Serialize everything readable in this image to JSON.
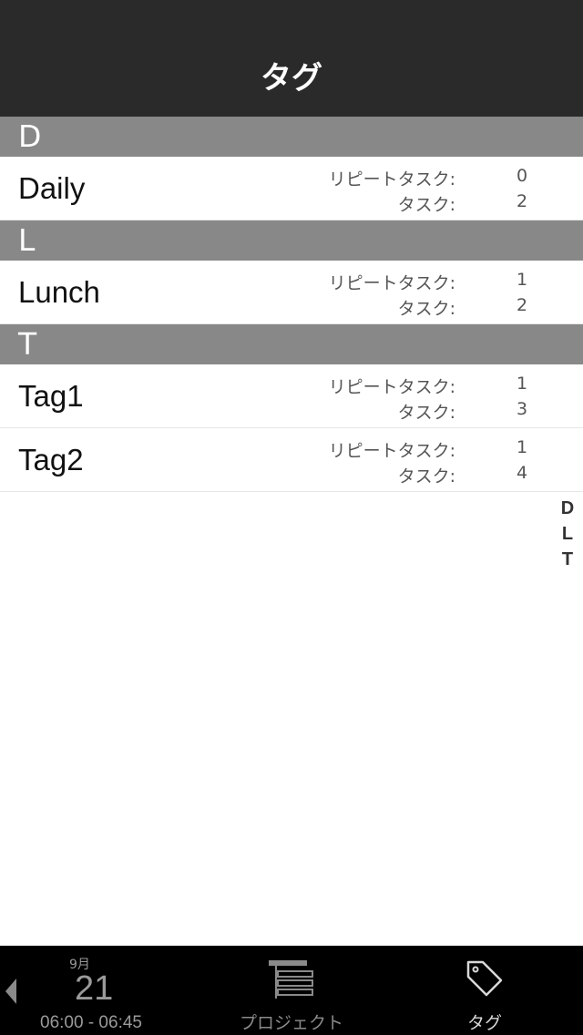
{
  "nav": {
    "title": "タグ"
  },
  "labels": {
    "repeat_tasks": "リピートタスク:",
    "tasks": "タスク:"
  },
  "sections": [
    {
      "letter": "D",
      "rows": [
        {
          "name": "Daily",
          "repeat": "0",
          "tasks": "2"
        }
      ]
    },
    {
      "letter": "L",
      "rows": [
        {
          "name": "Lunch",
          "repeat": "1",
          "tasks": "2"
        }
      ]
    },
    {
      "letter": "T",
      "rows": [
        {
          "name": "Tag1",
          "repeat": "1",
          "tasks": "3"
        },
        {
          "name": "Tag2",
          "repeat": "1",
          "tasks": "4"
        }
      ]
    }
  ],
  "index": [
    "D",
    "L",
    "T"
  ],
  "tab_bar": {
    "date_month": "9月",
    "date_day": "21",
    "date_time": "06:00 - 06:45",
    "projects_label": "プロジェクト",
    "tags_label": "タグ"
  },
  "colors": {
    "nav_bg": "#2a2a2a",
    "section_bg": "#888888",
    "tab_bar_bg": "#000000"
  }
}
